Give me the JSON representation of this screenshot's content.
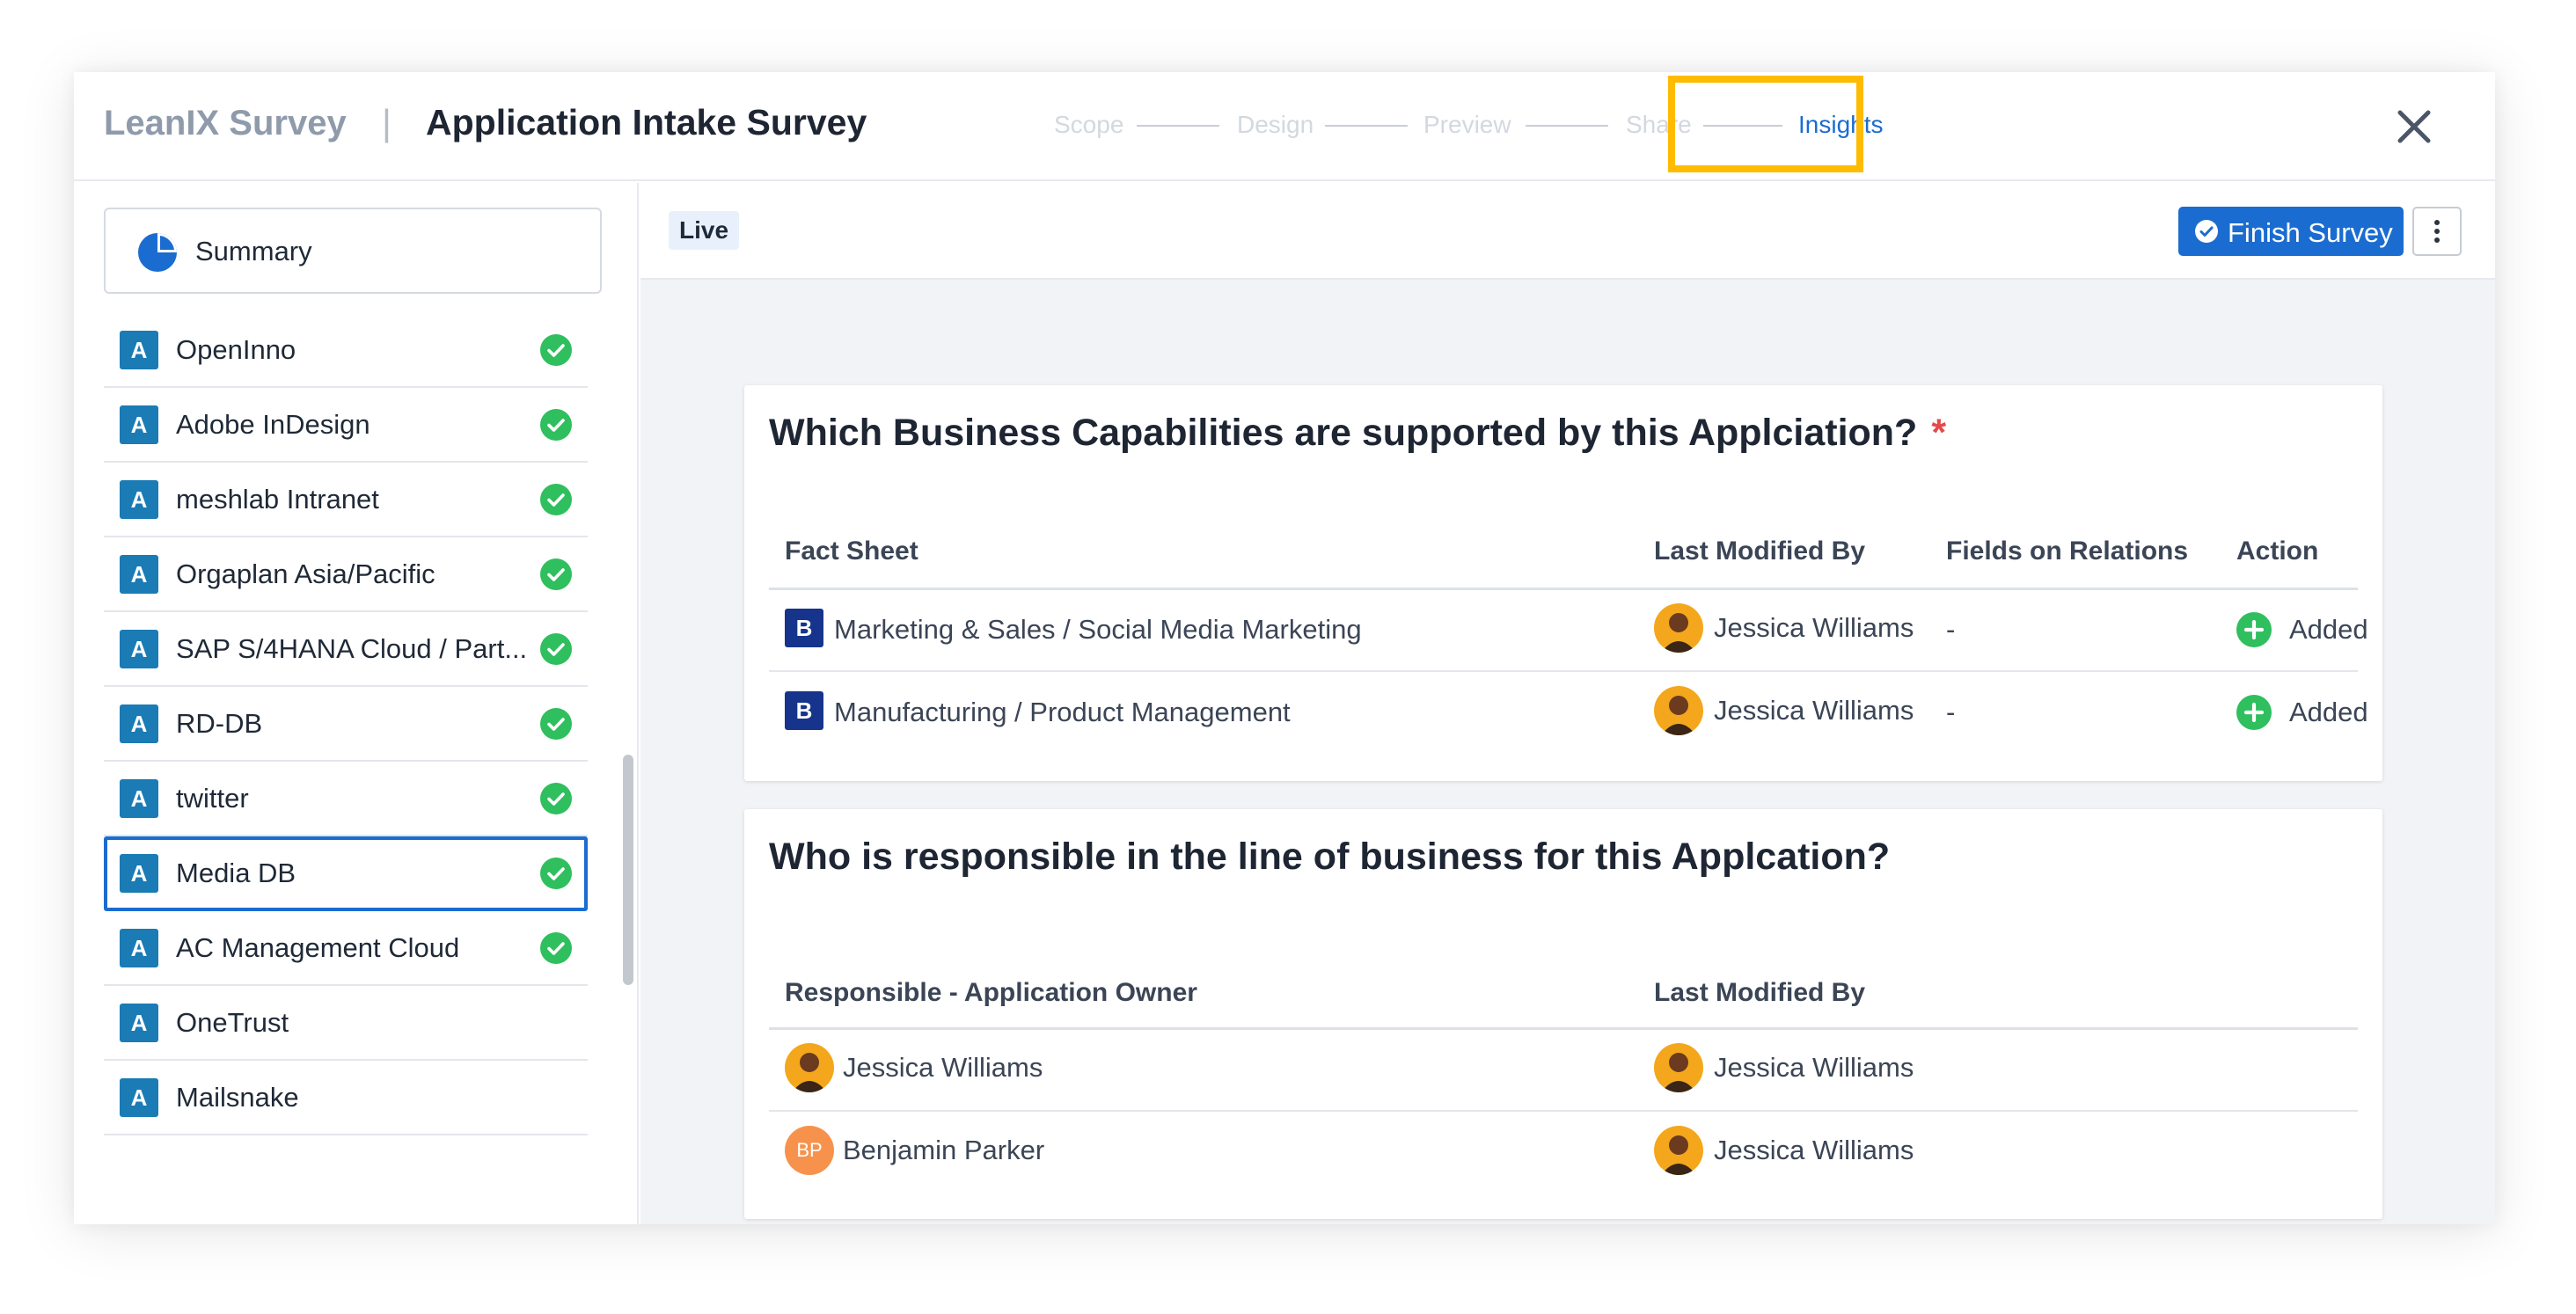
{
  "header": {
    "brand": "LeanIX Survey",
    "separator": "|",
    "title": "Application Intake Survey",
    "steps": [
      "Scope",
      "Design",
      "Preview",
      "Share",
      "Insights"
    ],
    "active_step": "Insights",
    "close_icon": "close-icon"
  },
  "sidebar": {
    "summary_label": "Summary",
    "items": [
      {
        "badge": "A",
        "name": "OpenInno",
        "status": "complete"
      },
      {
        "badge": "A",
        "name": "Adobe InDesign",
        "status": "complete"
      },
      {
        "badge": "A",
        "name": "meshlab Intranet",
        "status": "complete"
      },
      {
        "badge": "A",
        "name": "Orgaplan Asia/Pacific",
        "status": "complete"
      },
      {
        "badge": "A",
        "name": "SAP S/4HANA Cloud / Part...",
        "status": "complete"
      },
      {
        "badge": "A",
        "name": "RD-DB",
        "status": "complete"
      },
      {
        "badge": "A",
        "name": "twitter",
        "status": "complete"
      },
      {
        "badge": "A",
        "name": "Media DB",
        "status": "complete",
        "selected": true
      },
      {
        "badge": "A",
        "name": "AC Management Cloud",
        "status": "complete"
      },
      {
        "badge": "A",
        "name": "OneTrust",
        "status": "none"
      },
      {
        "badge": "A",
        "name": "Mailsnake",
        "status": "none"
      }
    ]
  },
  "toolbar": {
    "live_label": "Live",
    "finish_label": "Finish Survey"
  },
  "question1": {
    "title": "Which Business Capabilities are supported by this Applciation?",
    "required_mark": "*",
    "columns": [
      "Fact Sheet",
      "Last Modified By",
      "Fields on Relations",
      "Action"
    ],
    "rows": [
      {
        "badge": "B",
        "fact_sheet": "Marketing & Sales / Social Media Marketing",
        "modified_by": "Jessica Williams",
        "fields": "-",
        "action": "Added"
      },
      {
        "badge": "B",
        "fact_sheet": "Manufacturing / Product Management",
        "modified_by": "Jessica Williams",
        "fields": "-",
        "action": "Added"
      }
    ]
  },
  "question2": {
    "title": "Who is responsible in the line of business for this Applcation?",
    "columns": [
      "Responsible - Application Owner",
      "Last Modified By"
    ],
    "rows": [
      {
        "owner": "Jessica Williams",
        "owner_initials": "",
        "modified_by": "Jessica Williams"
      },
      {
        "owner": "Benjamin Parker",
        "owner_initials": "BP",
        "modified_by": "Jessica Williams"
      }
    ]
  },
  "colors": {
    "accent": "#1b6cd0",
    "highlight": "#ffbb00",
    "app_badge": "#1a7bb5",
    "capability_badge": "#16348c",
    "success": "#2fbf5e",
    "avatar": "#f4a71c",
    "avatar_bp": "#f7924c",
    "required": "#e34b4b"
  }
}
